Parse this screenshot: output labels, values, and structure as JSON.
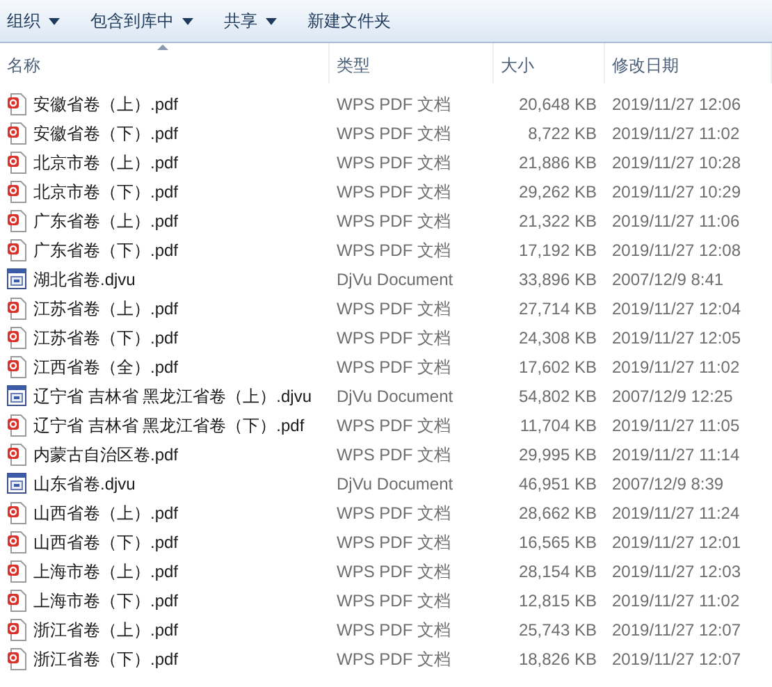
{
  "toolbar": [
    {
      "label": "组织",
      "dropdown": true
    },
    {
      "label": "包含到库中",
      "dropdown": true
    },
    {
      "label": "共享",
      "dropdown": true
    },
    {
      "label": "新建文件夹",
      "dropdown": false
    }
  ],
  "columns": [
    {
      "label": "名称",
      "sorted": true
    },
    {
      "label": "类型",
      "sorted": false
    },
    {
      "label": "大小",
      "sorted": false
    },
    {
      "label": "修改日期",
      "sorted": false
    }
  ],
  "files": [
    {
      "kind": "pdf",
      "name": "安徽省卷（上）.pdf",
      "type": "WPS PDF 文档",
      "size": "20,648 KB",
      "date": "2019/11/27 12:06"
    },
    {
      "kind": "pdf",
      "name": "安徽省卷（下）.pdf",
      "type": "WPS PDF 文档",
      "size": "8,722 KB",
      "date": "2019/11/27 11:02"
    },
    {
      "kind": "pdf",
      "name": "北京市卷（上）.pdf",
      "type": "WPS PDF 文档",
      "size": "21,886 KB",
      "date": "2019/11/27 10:28"
    },
    {
      "kind": "pdf",
      "name": "北京市卷（下）.pdf",
      "type": "WPS PDF 文档",
      "size": "29,262 KB",
      "date": "2019/11/27 10:29"
    },
    {
      "kind": "pdf",
      "name": "广东省卷（上）.pdf",
      "type": "WPS PDF 文档",
      "size": "21,322 KB",
      "date": "2019/11/27 11:06"
    },
    {
      "kind": "pdf",
      "name": "广东省卷（下）.pdf",
      "type": "WPS PDF 文档",
      "size": "17,192 KB",
      "date": "2019/11/27 12:08"
    },
    {
      "kind": "djvu",
      "name": "湖北省卷.djvu",
      "type": "DjVu Document",
      "size": "33,896 KB",
      "date": "2007/12/9 8:41"
    },
    {
      "kind": "pdf",
      "name": "江苏省卷（上）.pdf",
      "type": "WPS PDF 文档",
      "size": "27,714 KB",
      "date": "2019/11/27 12:04"
    },
    {
      "kind": "pdf",
      "name": "江苏省卷（下）.pdf",
      "type": "WPS PDF 文档",
      "size": "24,308 KB",
      "date": "2019/11/27 12:05"
    },
    {
      "kind": "pdf",
      "name": "江西省卷（全）.pdf",
      "type": "WPS PDF 文档",
      "size": "17,602 KB",
      "date": "2019/11/27 11:02"
    },
    {
      "kind": "djvu",
      "name": "辽宁省 吉林省 黑龙江省卷（上）.djvu",
      "type": "DjVu Document",
      "size": "54,802 KB",
      "date": "2007/12/9 12:25"
    },
    {
      "kind": "pdf",
      "name": "辽宁省 吉林省 黑龙江省卷（下）.pdf",
      "type": "WPS PDF 文档",
      "size": "11,704 KB",
      "date": "2019/11/27 11:05"
    },
    {
      "kind": "pdf",
      "name": "内蒙古自治区卷.pdf",
      "type": "WPS PDF 文档",
      "size": "29,995 KB",
      "date": "2019/11/27 11:14"
    },
    {
      "kind": "djvu",
      "name": "山东省卷.djvu",
      "type": "DjVu Document",
      "size": "46,951 KB",
      "date": "2007/12/9 8:39"
    },
    {
      "kind": "pdf",
      "name": "山西省卷（上）.pdf",
      "type": "WPS PDF 文档",
      "size": "28,662 KB",
      "date": "2019/11/27 11:24"
    },
    {
      "kind": "pdf",
      "name": "山西省卷（下）.pdf",
      "type": "WPS PDF 文档",
      "size": "16,565 KB",
      "date": "2019/11/27 12:01"
    },
    {
      "kind": "pdf",
      "name": "上海市卷（上）.pdf",
      "type": "WPS PDF 文档",
      "size": "28,154 KB",
      "date": "2019/11/27 12:03"
    },
    {
      "kind": "pdf",
      "name": "上海市卷（下）.pdf",
      "type": "WPS PDF 文档",
      "size": "12,815 KB",
      "date": "2019/11/27 11:02"
    },
    {
      "kind": "pdf",
      "name": "浙江省卷（上）.pdf",
      "type": "WPS PDF 文档",
      "size": "25,743 KB",
      "date": "2019/11/27 12:07"
    },
    {
      "kind": "pdf",
      "name": "浙江省卷（下）.pdf",
      "type": "WPS PDF 文档",
      "size": "18,826 KB",
      "date": "2019/11/27 12:07"
    }
  ]
}
